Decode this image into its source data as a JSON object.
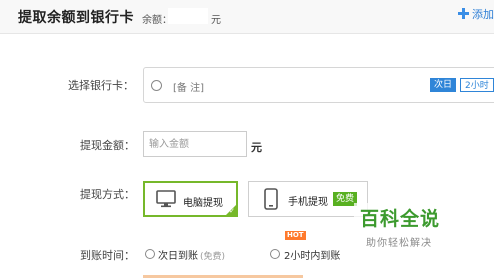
{
  "header": {
    "title": "提取余额到银行卡",
    "balance_label": "余额：",
    "balance_unit": "元",
    "add_label": "添加"
  },
  "form": {
    "card": {
      "label": "选择银行卡：",
      "note": "[备 注]",
      "tags": [
        "次日",
        "2小时"
      ]
    },
    "amount": {
      "label": "提现金额：",
      "placeholder": "输入金额",
      "unit": "元"
    },
    "method": {
      "label": "提现方式：",
      "options": [
        {
          "label": "电脑提现",
          "icon": "monitor-icon",
          "selected": true
        },
        {
          "label": "手机提现",
          "icon": "phone-icon",
          "badge": "免费",
          "selected": false
        }
      ]
    },
    "arrival": {
      "label": "到账时间：",
      "options": [
        {
          "label": "次日到账",
          "sub": "(免费)"
        },
        {
          "label": "2小时内到账",
          "badge": "HOT"
        }
      ]
    }
  },
  "watermark": {
    "title": "百科全说",
    "subtitle": "助你轻松解决"
  },
  "colors": {
    "accent_blue": "#2f85d8",
    "selected_green": "#76b82a",
    "hot_orange": "#ff7a2d",
    "watermark_green": "#3c9a2e"
  }
}
